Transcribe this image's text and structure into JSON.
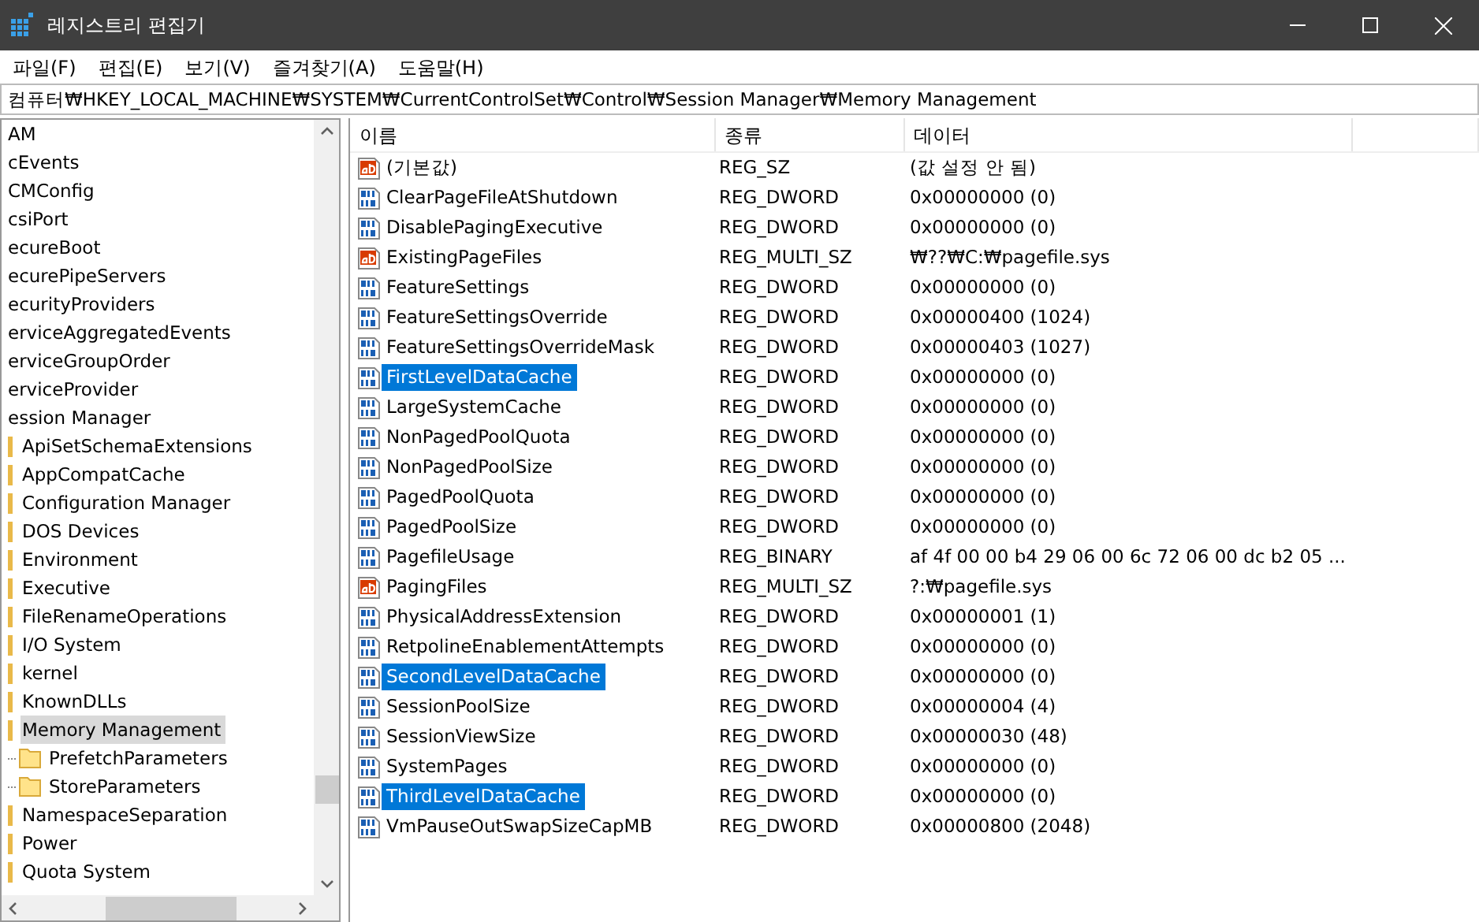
{
  "window": {
    "title": "레지스트리 편집기"
  },
  "menu": [
    "파일(F)",
    "편집(E)",
    "보기(V)",
    "즐겨찾기(A)",
    "도움말(H)"
  ],
  "address": "컴퓨터₩HKEY_LOCAL_MACHINE₩SYSTEM₩CurrentControlSet₩Control₩Session Manager₩Memory Management",
  "tree": [
    {
      "label": "AM",
      "selected": false
    },
    {
      "label": "cEvents",
      "selected": false
    },
    {
      "label": "CMConfig",
      "selected": false
    },
    {
      "label": "csiPort",
      "selected": false
    },
    {
      "label": "ecureBoot",
      "selected": false
    },
    {
      "label": "ecurePipeServers",
      "selected": false
    },
    {
      "label": "ecurityProviders",
      "selected": false
    },
    {
      "label": "erviceAggregatedEvents",
      "selected": false
    },
    {
      "label": "erviceGroupOrder",
      "selected": false
    },
    {
      "label": "erviceProvider",
      "selected": false
    },
    {
      "label": "ession Manager",
      "selected": false,
      "children": [
        {
          "label": "ApiSetSchemaExtensions",
          "selected": false
        },
        {
          "label": "AppCompatCache",
          "selected": false
        },
        {
          "label": "Configuration Manager",
          "selected": false
        },
        {
          "label": "DOS Devices",
          "selected": false
        },
        {
          "label": "Environment",
          "selected": false
        },
        {
          "label": "Executive",
          "selected": false
        },
        {
          "label": "FileRenameOperations",
          "selected": false
        },
        {
          "label": "I/O System",
          "selected": false
        },
        {
          "label": "kernel",
          "selected": false
        },
        {
          "label": "KnownDLLs",
          "selected": false
        },
        {
          "label": "Memory Management",
          "selected": true,
          "children": [
            {
              "label": "PrefetchParameters",
              "selected": false
            },
            {
              "label": "StoreParameters",
              "selected": false
            }
          ]
        },
        {
          "label": "NamespaceSeparation",
          "selected": false
        },
        {
          "label": "Power",
          "selected": false
        },
        {
          "label": "Quota System",
          "selected": false
        }
      ]
    }
  ],
  "table": {
    "columns": [
      "이름",
      "종류",
      "데이터"
    ],
    "rows": [
      {
        "kind": "string",
        "name": "(기본값)",
        "type": "REG_SZ",
        "data": "(값 설정 안 됨)",
        "selected": false
      },
      {
        "kind": "binary",
        "name": "ClearPageFileAtShutdown",
        "type": "REG_DWORD",
        "data": "0x00000000 (0)",
        "selected": false
      },
      {
        "kind": "binary",
        "name": "DisablePagingExecutive",
        "type": "REG_DWORD",
        "data": "0x00000000 (0)",
        "selected": false
      },
      {
        "kind": "string",
        "name": "ExistingPageFiles",
        "type": "REG_MULTI_SZ",
        "data": "₩??₩C:₩pagefile.sys",
        "selected": false
      },
      {
        "kind": "binary",
        "name": "FeatureSettings",
        "type": "REG_DWORD",
        "data": "0x00000000 (0)",
        "selected": false
      },
      {
        "kind": "binary",
        "name": "FeatureSettingsOverride",
        "type": "REG_DWORD",
        "data": "0x00000400 (1024)",
        "selected": false
      },
      {
        "kind": "binary",
        "name": "FeatureSettingsOverrideMask",
        "type": "REG_DWORD",
        "data": "0x00000403 (1027)",
        "selected": false
      },
      {
        "kind": "binary",
        "name": "FirstLevelDataCache",
        "type": "REG_DWORD",
        "data": "0x00000000 (0)",
        "selected": true
      },
      {
        "kind": "binary",
        "name": "LargeSystemCache",
        "type": "REG_DWORD",
        "data": "0x00000000 (0)",
        "selected": false
      },
      {
        "kind": "binary",
        "name": "NonPagedPoolQuota",
        "type": "REG_DWORD",
        "data": "0x00000000 (0)",
        "selected": false
      },
      {
        "kind": "binary",
        "name": "NonPagedPoolSize",
        "type": "REG_DWORD",
        "data": "0x00000000 (0)",
        "selected": false
      },
      {
        "kind": "binary",
        "name": "PagedPoolQuota",
        "type": "REG_DWORD",
        "data": "0x00000000 (0)",
        "selected": false
      },
      {
        "kind": "binary",
        "name": "PagedPoolSize",
        "type": "REG_DWORD",
        "data": "0x00000000 (0)",
        "selected": false
      },
      {
        "kind": "binary",
        "name": "PagefileUsage",
        "type": "REG_BINARY",
        "data": "af 4f 00 00 b4 29 06 00 6c 72 06 00 dc b2 05 ...",
        "selected": false
      },
      {
        "kind": "string",
        "name": "PagingFiles",
        "type": "REG_MULTI_SZ",
        "data": "?:₩pagefile.sys",
        "selected": false
      },
      {
        "kind": "binary",
        "name": "PhysicalAddressExtension",
        "type": "REG_DWORD",
        "data": "0x00000001 (1)",
        "selected": false
      },
      {
        "kind": "binary",
        "name": "RetpolineEnablementAttempts",
        "type": "REG_DWORD",
        "data": "0x00000000 (0)",
        "selected": false
      },
      {
        "kind": "binary",
        "name": "SecondLevelDataCache",
        "type": "REG_DWORD",
        "data": "0x00000000 (0)",
        "selected": true
      },
      {
        "kind": "binary",
        "name": "SessionPoolSize",
        "type": "REG_DWORD",
        "data": "0x00000004 (4)",
        "selected": false
      },
      {
        "kind": "binary",
        "name": "SessionViewSize",
        "type": "REG_DWORD",
        "data": "0x00000030 (48)",
        "selected": false
      },
      {
        "kind": "binary",
        "name": "SystemPages",
        "type": "REG_DWORD",
        "data": "0x00000000 (0)",
        "selected": false
      },
      {
        "kind": "binary",
        "name": "ThirdLevelDataCache",
        "type": "REG_DWORD",
        "data": "0x00000000 (0)",
        "selected": true
      },
      {
        "kind": "binary",
        "name": "VmPauseOutSwapSizeCapMB",
        "type": "REG_DWORD",
        "data": "0x00000800 (2048)",
        "selected": false
      }
    ]
  }
}
